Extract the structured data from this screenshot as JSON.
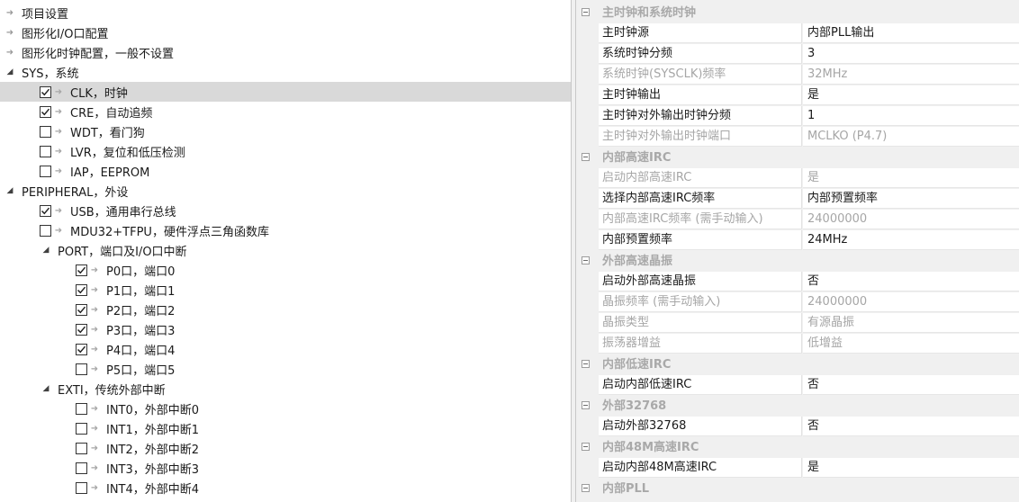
{
  "tree": {
    "items": [
      {
        "label": "项目设置",
        "has_checkbox": false,
        "checked": false,
        "expander": "leaf"
      },
      {
        "label": "图形化I/O口配置",
        "has_checkbox": false,
        "checked": false,
        "expander": "leaf"
      },
      {
        "label": "图形化时钟配置，一般不设置",
        "has_checkbox": false,
        "checked": false,
        "expander": "leaf"
      },
      {
        "label": "SYS，系统",
        "has_checkbox": false,
        "checked": false,
        "expander": "expanded"
      },
      {
        "label": "CLK，时钟",
        "has_checkbox": true,
        "checked": true,
        "selected": true
      },
      {
        "label": "CRE，自动追频",
        "has_checkbox": true,
        "checked": true
      },
      {
        "label": "WDT，看门狗",
        "has_checkbox": true,
        "checked": false
      },
      {
        "label": "LVR，复位和低压检测",
        "has_checkbox": true,
        "checked": false
      },
      {
        "label": "IAP，EEPROM",
        "has_checkbox": true,
        "checked": false
      },
      {
        "label": "PERIPHERAL，外设",
        "has_checkbox": false,
        "checked": false,
        "expander": "expanded"
      },
      {
        "label": "USB，通用串行总线",
        "has_checkbox": true,
        "checked": true
      },
      {
        "label": "MDU32+TFPU，硬件浮点三角函数库",
        "has_checkbox": true,
        "checked": false
      },
      {
        "label": "PORT，端口及I/O口中断",
        "has_checkbox": false,
        "checked": false,
        "expander": "expanded"
      },
      {
        "label": "P0口，端口0",
        "has_checkbox": true,
        "checked": true
      },
      {
        "label": "P1口，端口1",
        "has_checkbox": true,
        "checked": true
      },
      {
        "label": "P2口，端口2",
        "has_checkbox": true,
        "checked": true
      },
      {
        "label": "P3口，端口3",
        "has_checkbox": true,
        "checked": true
      },
      {
        "label": "P4口，端口4",
        "has_checkbox": true,
        "checked": true
      },
      {
        "label": "P5口，端口5",
        "has_checkbox": true,
        "checked": false
      },
      {
        "label": "EXTI，传统外部中断",
        "has_checkbox": false,
        "checked": false,
        "expander": "expanded"
      },
      {
        "label": "INT0，外部中断0",
        "has_checkbox": true,
        "checked": false
      },
      {
        "label": "INT1，外部中断1",
        "has_checkbox": true,
        "checked": false
      },
      {
        "label": "INT2，外部中断2",
        "has_checkbox": true,
        "checked": false
      },
      {
        "label": "INT3，外部中断3",
        "has_checkbox": true,
        "checked": false
      },
      {
        "label": "INT4，外部中断4",
        "has_checkbox": true,
        "checked": false
      }
    ]
  },
  "grid": {
    "rows": [
      {
        "category": "主时钟和系统时钟"
      },
      {
        "name": "主时钟源",
        "value": "内部PLL输出",
        "readonly": false
      },
      {
        "name": "系统时钟分频",
        "value": "3",
        "readonly": false
      },
      {
        "name": "系统时钟(SYSCLK)频率",
        "value": "32MHz",
        "readonly": true
      },
      {
        "name": "主时钟输出",
        "value": "是",
        "readonly": false
      },
      {
        "name": "主时钟对外输出时钟分频",
        "value": "1",
        "readonly": false
      },
      {
        "name": "主时钟对外输出时钟端口",
        "value": "MCLKO (P4.7)",
        "readonly": true
      },
      {
        "category": "内部高速IRC"
      },
      {
        "name": "启动内部高速IRC",
        "value": "是",
        "readonly": true
      },
      {
        "name": "选择内部高速IRC频率",
        "value": "内部预置频率",
        "readonly": false
      },
      {
        "name": "内部高速IRC频率 (需手动输入)",
        "value": "24000000",
        "readonly": true
      },
      {
        "name": "内部预置频率",
        "value": "24MHz",
        "readonly": false
      },
      {
        "category": "外部高速晶振"
      },
      {
        "name": "启动外部高速晶振",
        "value": "否",
        "readonly": false
      },
      {
        "name": "晶振频率 (需手动输入)",
        "value": "24000000",
        "readonly": true
      },
      {
        "name": "晶振类型",
        "value": "有源晶振",
        "readonly": true
      },
      {
        "name": "振荡器增益",
        "value": "低增益",
        "readonly": true
      },
      {
        "category": "内部低速IRC"
      },
      {
        "name": "启动内部低速IRC",
        "value": "否",
        "readonly": false
      },
      {
        "category": "外部32768"
      },
      {
        "name": "启动外部32768",
        "value": "否",
        "readonly": false
      },
      {
        "category": "内部48M高速IRC"
      },
      {
        "name": "启动内部48M高速IRC",
        "value": "是",
        "readonly": false
      },
      {
        "category": "内部PLL"
      }
    ]
  }
}
